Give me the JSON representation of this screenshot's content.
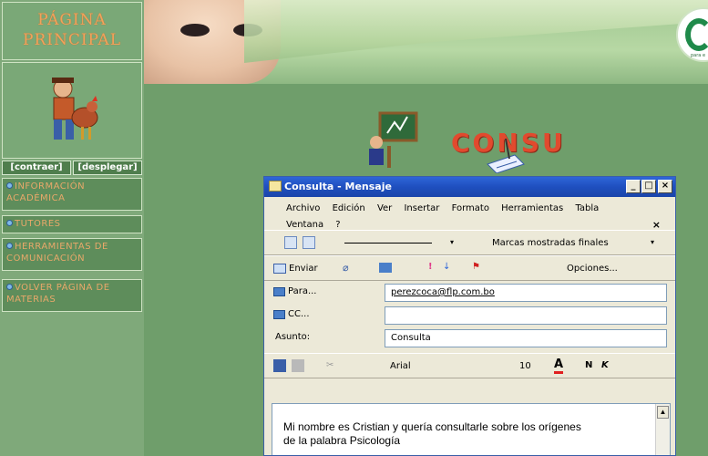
{
  "sidebar": {
    "title_line1": "PÁGINA",
    "title_line2": "PRINCIPAL",
    "collapse": "[contraer]",
    "expand": "[desplegar]",
    "items": [
      {
        "label": "INFORMACIÓN ACADÉMICA"
      },
      {
        "label": "TUTORES"
      },
      {
        "label": "HERRAMIENTAS DE COMUNICACIÓN"
      },
      {
        "label": "VOLVER PÁGINA DE MATERIAS"
      }
    ]
  },
  "banner": {
    "logo_caption": "para e"
  },
  "heading": {
    "title": "CONSU"
  },
  "window": {
    "title": "Consulta - Mensaje",
    "controls": {
      "minimize": "_",
      "maximize": "□",
      "close": "×"
    },
    "menu": [
      "Archivo",
      "Edición",
      "Ver",
      "Insertar",
      "Formato",
      "Herramientas",
      "Tabla",
      "Ventana",
      "?"
    ],
    "menu_close": "×",
    "toolbar1": {
      "markup_select": "Marcas mostradas finales"
    },
    "toolbar2": {
      "send": "Enviar",
      "options": "Opciones..."
    },
    "fields": {
      "to_label": "Para...",
      "to_value": "perezcoca@flp.com.bo",
      "cc_label": "CC...",
      "cc_value": "",
      "subject_label": "Asunto:",
      "subject_value": "Consulta"
    },
    "format_toolbar": {
      "font": "Arial",
      "size": "10",
      "bold": "N",
      "italic": "K"
    },
    "body_text_line1": "Mi nombre es Cristian y quería consultarle sobre los orígenes",
    "body_text_line2": "de  la palabra Psicología"
  },
  "colors": {
    "background": "#6f9e6b",
    "menu_text": "#e8a86a",
    "heading": "#e14a2e",
    "titlebar": "#2f66d8"
  }
}
